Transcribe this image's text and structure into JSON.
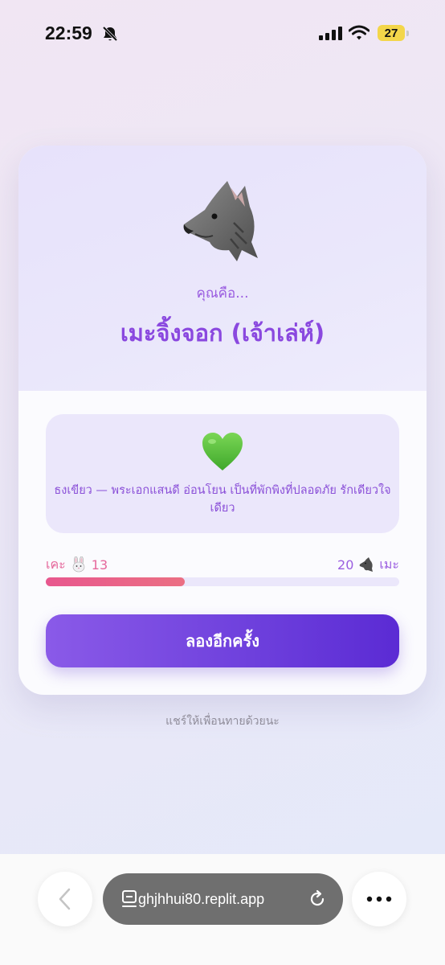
{
  "status_bar": {
    "time": "22:59",
    "battery": "27",
    "icons": [
      "bell-muted-icon",
      "signal-icon",
      "wifi-icon",
      "battery-icon"
    ]
  },
  "result": {
    "animal_icon": "wolf-icon",
    "intro": "คุณคือ...",
    "name": "เมะจิ้งจอก (เจ้าเล่ห์)",
    "heart_icon": "green-heart-icon",
    "heart_color": "#5cc23c",
    "description": "ธงเขียว — พระเอกแสนดี อ่อนโยน เป็นที่พักพิงที่ปลอดภัย รักเดียวใจเดียว"
  },
  "score": {
    "left_label": "เคะ",
    "left_icon": "rabbit-icon",
    "left_value": "13",
    "right_value": "20",
    "right_icon": "horse-icon",
    "right_label": "เมะ",
    "progress_fraction": 0.394
  },
  "actions": {
    "retry_label": "ลองอีกครั้ง"
  },
  "share_hint": "แชร์ให้เพื่อนทายด้วยนะ",
  "browser": {
    "url": "ghjhhui80.replit.app",
    "icons": [
      "back-chevron-icon",
      "tabs-icon",
      "reload-icon",
      "more-icon"
    ]
  },
  "colors": {
    "accent": "#8a48df",
    "button": "#6d3fdc",
    "progress": "#e8578e"
  }
}
